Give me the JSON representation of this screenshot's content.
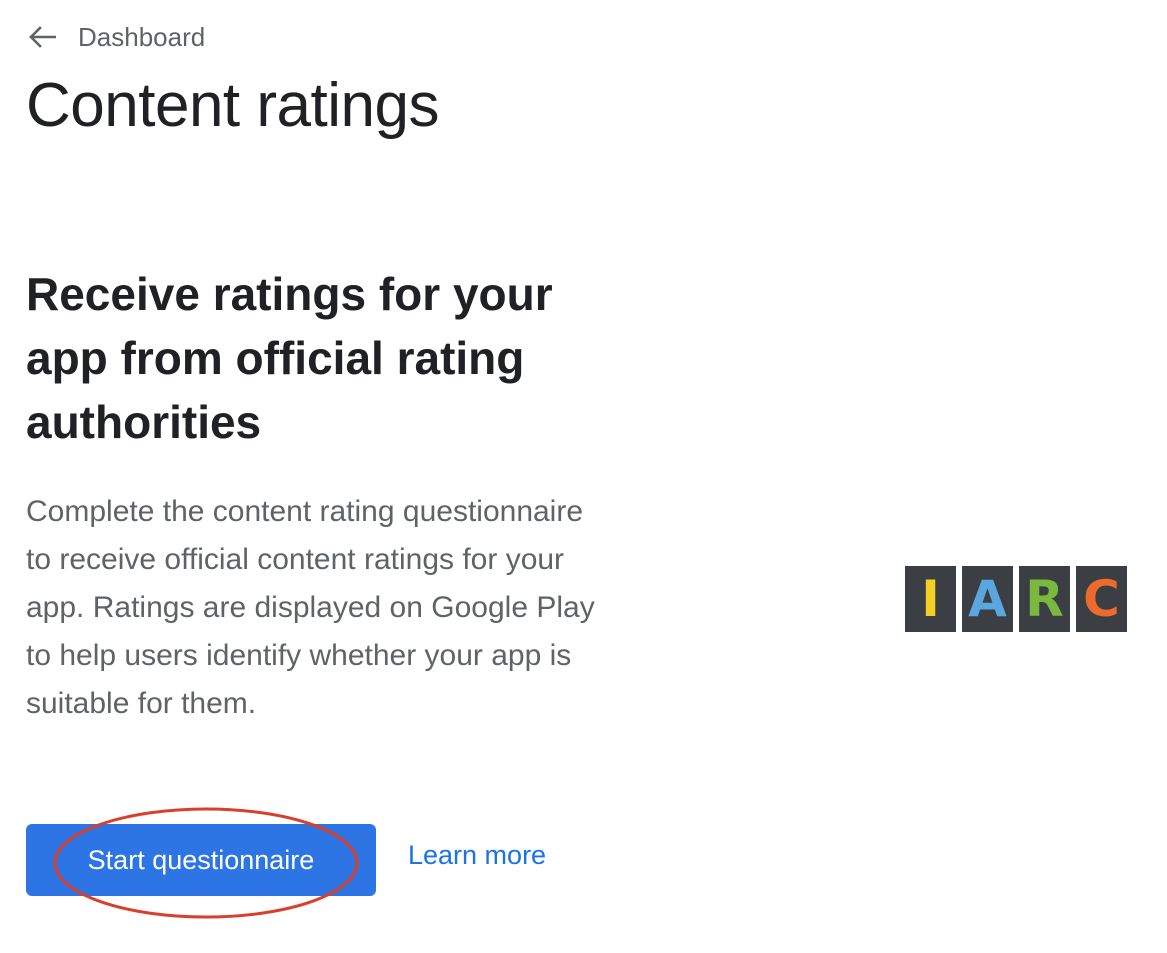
{
  "nav": {
    "back_label": "Dashboard"
  },
  "page": {
    "title": "Content ratings"
  },
  "section": {
    "heading": "Receive ratings for your app from official rating authorities",
    "description": "Complete the content rating questionnaire to receive official content ratings for your app. Ratings are displayed on Google Play to help users identify whether your app is suitable for them."
  },
  "actions": {
    "start_label": "Start questionnaire",
    "learn_more_label": "Learn more"
  },
  "logo": {
    "letters": [
      {
        "char": "I",
        "color": "#f3cf24"
      },
      {
        "char": "A",
        "color": "#5aa7e0"
      },
      {
        "char": "R",
        "color": "#7ab83e"
      },
      {
        "char": "C",
        "color": "#ec6b2c"
      }
    ]
  },
  "colors": {
    "primary_button": "#2d74e5",
    "link": "#1a73e8",
    "annotation": "#d9402b"
  }
}
